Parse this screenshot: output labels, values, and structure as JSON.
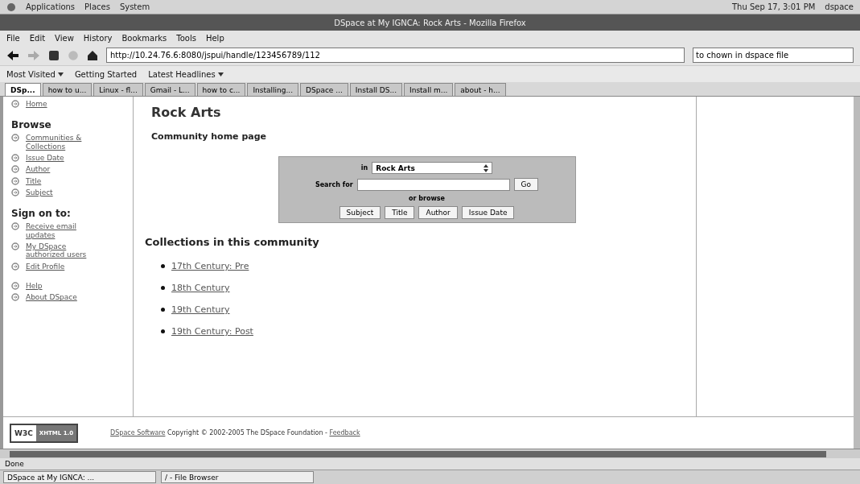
{
  "top_panel": {
    "menus": [
      "Applications",
      "Places",
      "System"
    ],
    "clock": "Thu Sep 17, 3:01 PM",
    "user": "dspace"
  },
  "window": {
    "title": "DSpace at My IGNCA: Rock Arts - Mozilla Firefox"
  },
  "menu_bar": [
    "File",
    "Edit",
    "View",
    "History",
    "Bookmarks",
    "Tools",
    "Help"
  ],
  "address_bar": {
    "value": "http://10.24.76.6:8080/jspui/handle/123456789/112"
  },
  "search_bar": {
    "value": "to chown in dspace file"
  },
  "bookmarks": [
    {
      "label": "Most Visited",
      "dropdown": true
    },
    {
      "label": "Getting Started",
      "dropdown": false
    },
    {
      "label": "Latest Headlines",
      "dropdown": true
    }
  ],
  "tabs": [
    {
      "label": "DSp...",
      "selected": true
    },
    {
      "label": "how to u...",
      "selected": false
    },
    {
      "label": "Linux - fl...",
      "selected": false
    },
    {
      "label": "Gmail - L...",
      "selected": false
    },
    {
      "label": "how to c...",
      "selected": false
    },
    {
      "label": "Installing...",
      "selected": false
    },
    {
      "label": "DSpace ...",
      "selected": false
    },
    {
      "label": "Install DS...",
      "selected": false
    },
    {
      "label": "Install m...",
      "selected": false
    },
    {
      "label": "about - h...",
      "selected": false
    }
  ],
  "sidebar": {
    "sections": [
      {
        "items": [
          "Home"
        ]
      },
      {
        "heading": "Browse",
        "items": [
          "Communities & Collections",
          "Issue Date",
          "Author",
          "Title",
          "Subject"
        ]
      },
      {
        "heading": "Sign on to:",
        "items": [
          "Receive email updates",
          "My DSpace authorized users",
          "Edit Profile"
        ]
      },
      {
        "items": [
          "Help",
          "About DSpace"
        ]
      }
    ]
  },
  "page": {
    "title": "Rock Arts",
    "subtitle": "Community home page",
    "search": {
      "in_label": "in",
      "scope": "Rock Arts",
      "search_label": "Search for",
      "go": "Go",
      "browse_label": "or browse",
      "browse_buttons": [
        "Subject",
        "Title",
        "Author",
        "Issue Date"
      ]
    },
    "collections_heading": "Collections in this community",
    "collections": [
      "17th Century: Pre",
      "18th Century",
      "19th Century",
      "19th Century: Post"
    ]
  },
  "footer": {
    "badge": [
      "W3C",
      "XHTML 1.0"
    ],
    "link": "DSpace Software",
    "text": "Copyright © 2002-2005 The DSpace Foundation -",
    "feedback": "Feedback"
  },
  "status_bar": "Done",
  "taskbar": [
    "DSpace at My IGNCA: ...",
    "/ - File Browser"
  ]
}
